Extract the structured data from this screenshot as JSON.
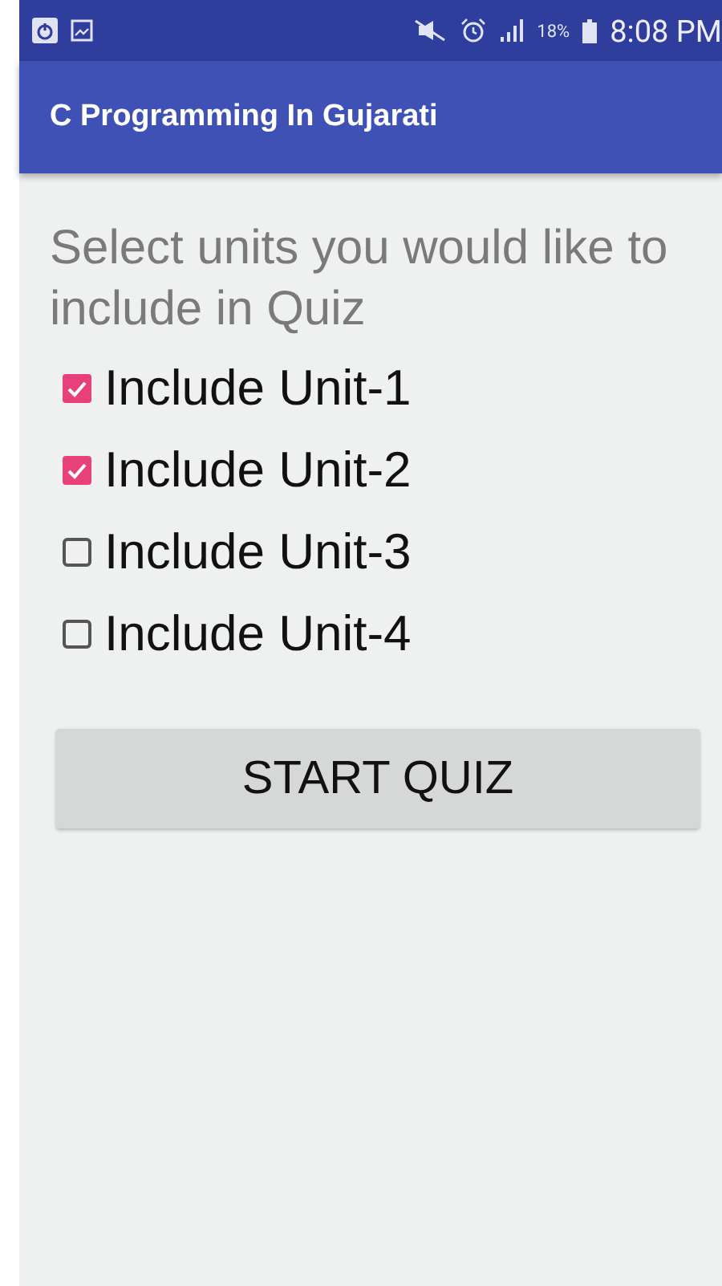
{
  "status_bar": {
    "battery": "18%",
    "time": "8:08 PM"
  },
  "toolbar": {
    "title": "C Programming In Gujarati"
  },
  "prompt": "Select units you would like to include in Quiz",
  "units": [
    {
      "label": "Include Unit-1",
      "checked": true
    },
    {
      "label": "Include Unit-2",
      "checked": true
    },
    {
      "label": "Include Unit-3",
      "checked": false
    },
    {
      "label": "Include Unit-4",
      "checked": false
    }
  ],
  "start_button": "START QUIZ"
}
